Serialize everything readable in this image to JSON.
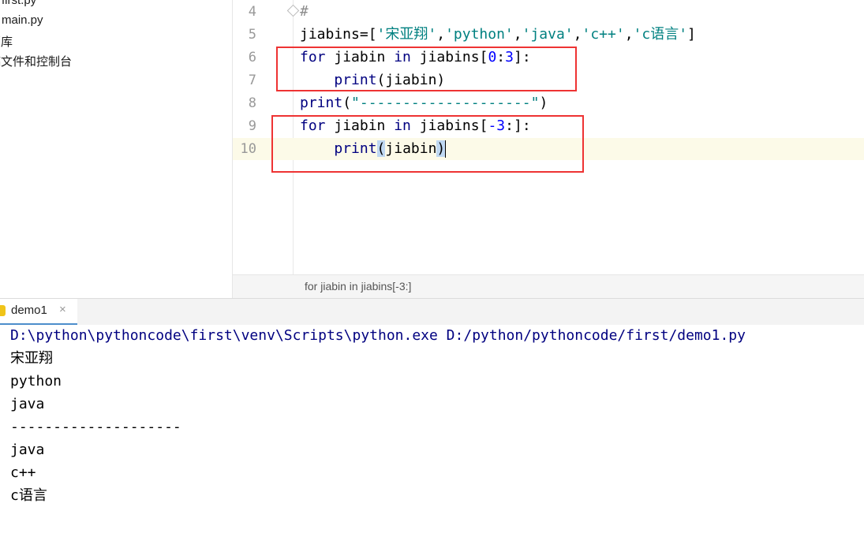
{
  "project_tree": {
    "items": [
      "first.py",
      "main.py",
      "部库",
      "稿文件和控制台"
    ]
  },
  "editor": {
    "lines": [
      {
        "num": "4",
        "tokens": [
          {
            "t": "#",
            "c": "cmt"
          }
        ]
      },
      {
        "num": "5",
        "tokens": [
          {
            "t": "jiabins=[",
            "c": ""
          },
          {
            "t": "'宋亚翔'",
            "c": "str"
          },
          {
            "t": ",",
            "c": ""
          },
          {
            "t": "'python'",
            "c": "str"
          },
          {
            "t": ",",
            "c": ""
          },
          {
            "t": "'java'",
            "c": "str"
          },
          {
            "t": ",",
            "c": ""
          },
          {
            "t": "'c++'",
            "c": "str"
          },
          {
            "t": ",",
            "c": ""
          },
          {
            "t": "'c语言'",
            "c": "str"
          },
          {
            "t": "]",
            "c": ""
          }
        ]
      },
      {
        "num": "6",
        "tokens": [
          {
            "t": "for",
            "c": "kw"
          },
          {
            "t": " jiabin ",
            "c": ""
          },
          {
            "t": "in",
            "c": "kw"
          },
          {
            "t": " jiabins[",
            "c": ""
          },
          {
            "t": "0",
            "c": "num-lit"
          },
          {
            "t": ":",
            "c": ""
          },
          {
            "t": "3",
            "c": "num-lit"
          },
          {
            "t": "]:",
            "c": ""
          }
        ]
      },
      {
        "num": "7",
        "tokens": [
          {
            "t": "    ",
            "c": ""
          },
          {
            "t": "print",
            "c": "bi"
          },
          {
            "t": "(jiabin)",
            "c": ""
          }
        ]
      },
      {
        "num": "8",
        "tokens": [
          {
            "t": "print",
            "c": "bi"
          },
          {
            "t": "(",
            "c": ""
          },
          {
            "t": "\"--------------------\"",
            "c": "str"
          },
          {
            "t": ")",
            "c": ""
          }
        ]
      },
      {
        "num": "9",
        "tokens": [
          {
            "t": "for",
            "c": "kw"
          },
          {
            "t": " jiabin ",
            "c": ""
          },
          {
            "t": "in",
            "c": "kw"
          },
          {
            "t": " jiabins[",
            "c": ""
          },
          {
            "t": "-3",
            "c": "num-lit"
          },
          {
            "t": ":]:",
            "c": ""
          }
        ]
      },
      {
        "num": "10",
        "tokens": [
          {
            "t": "    ",
            "c": ""
          },
          {
            "t": "print",
            "c": "bi"
          },
          {
            "t": "(",
            "c": "hl"
          },
          {
            "t": "jiabin",
            "c": ""
          },
          {
            "t": ")",
            "c": "hl"
          }
        ],
        "current": true
      }
    ]
  },
  "breadcrumb": {
    "text": "for jiabin in jiabins[-3:]"
  },
  "run": {
    "tab_label": "demo1",
    "close_glyph": "×",
    "command": "D:\\python\\pythoncode\\first\\venv\\Scripts\\python.exe D:/python/pythoncode/first/demo1.py",
    "output": [
      "宋亚翔",
      "python",
      "java",
      "--------------------",
      "java",
      "c++",
      "c语言"
    ]
  }
}
